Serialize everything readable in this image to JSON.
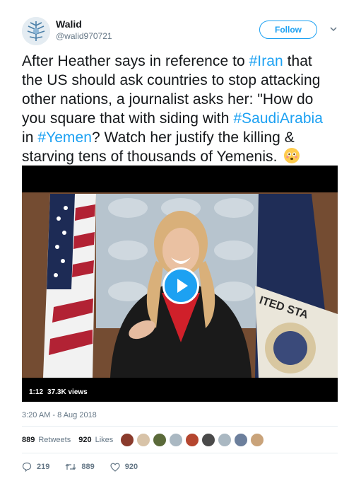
{
  "author": {
    "name": "Walid",
    "handle": "@walid970721"
  },
  "follow_label": "Follow",
  "tweet": {
    "lines": [
      [
        {
          "t": "After Heather says in reference to "
        },
        {
          "t": "#Iran",
          "tag": true
        },
        {
          "t": " that"
        }
      ],
      [
        {
          "t": "the US should ask countries to stop attacking"
        }
      ],
      [
        {
          "t": "other nations, a journalist asks her: \"How do"
        }
      ],
      [
        {
          "t": "you square that with siding with "
        },
        {
          "t": "#SaudiArabia",
          "tag": true
        }
      ],
      [
        {
          "t": "in "
        },
        {
          "t": "#Yemen",
          "tag": true
        },
        {
          "t": "? Watch her justify the killing &"
        }
      ],
      [
        {
          "t": "starving tens of thousands of Yemenis. "
        }
      ]
    ],
    "emoji": "flushed-face"
  },
  "video": {
    "duration": "1:12",
    "views": "37.3K views",
    "seal_text": "ITED STA"
  },
  "timestamp": "3:20 AM - 8 Aug 2018",
  "stats": {
    "retweets_count": "889",
    "retweets_label": "Retweets",
    "likes_count": "920",
    "likes_label": "Likes",
    "avatar_colors": [
      "#8a3b2c",
      "#d8c3a8",
      "#5b6a3a",
      "#aab8c2",
      "#b5462f",
      "#4a4a4a",
      "#aab8c2",
      "#6c7f9c",
      "#c9a37a"
    ]
  },
  "actions": {
    "replies": "219",
    "retweets": "889",
    "likes": "920"
  },
  "colors": {
    "accent": "#1da1f2",
    "muted": "#657786"
  }
}
